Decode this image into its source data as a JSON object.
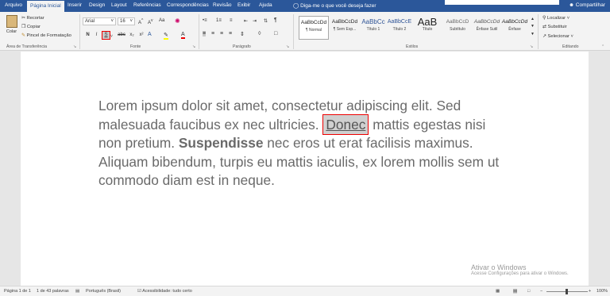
{
  "tabs": [
    "Arquivo",
    "Página Inicial",
    "Inserir",
    "Design",
    "Layout",
    "Referências",
    "Correspondências",
    "Revisão",
    "Exibir",
    "Ajuda"
  ],
  "tell_me": "Diga-me o que você deseja fazer",
  "share": "Compartilhar",
  "clipboard": {
    "paste": "Colar",
    "cut": "Recortar",
    "copy": "Copiar",
    "format_painter": "Pincel de Formatação",
    "label": "Área de Transferência"
  },
  "font": {
    "name": "Arial",
    "size": "16",
    "label": "Fonte",
    "bold": "N",
    "italic": "I",
    "underline": "S",
    "strike": "abc",
    "sub": "x₂",
    "sup": "x²"
  },
  "paragraph": {
    "label": "Parágrafo",
    "pilcrow": "¶"
  },
  "styles": {
    "label": "Estilos",
    "items": [
      {
        "preview": "AaBbCcDd",
        "name": "¶ Normal"
      },
      {
        "preview": "AaBbCcDd",
        "name": "¶ Sem Esp..."
      },
      {
        "preview": "AaBbCc",
        "name": "Título 1"
      },
      {
        "preview": "AaBbCcE",
        "name": "Título 2"
      },
      {
        "preview": "AaB",
        "name": "Título"
      },
      {
        "preview": "AaBbCcD",
        "name": "Subtítulo"
      },
      {
        "preview": "AaBbCcDd",
        "name": "Ênfase Sutil"
      },
      {
        "preview": "AaBbCcDd",
        "name": "Ênfase"
      }
    ]
  },
  "editing": {
    "label": "Editando",
    "find": "Localizar",
    "replace": "Substituir",
    "select": "Selecionar"
  },
  "document": {
    "before": "Lorem ipsum dolor sit amet, consectetur adipiscing elit. Sed malesuada faucibus ex nec ultricies. ",
    "selected": "Donec",
    "middle": " mattis egestas nisi non pretium. ",
    "bold": "Suspendisse",
    "after": " nec eros ut erat facilisis maximus. Aliquam bibendum, turpis eu mattis iaculis, ex lorem mollis sem ut commodo diam est in neque."
  },
  "watermark": {
    "line1": "Ativar o Windows",
    "line2": "Acesse Configurações para ativar o Windows."
  },
  "status": {
    "page": "Página 1 de 1",
    "words": "1 de 43 palavras",
    "language": "Português (Brasil)",
    "accessibility": "Acessibilidade: tudo certo",
    "zoom": "100%"
  }
}
